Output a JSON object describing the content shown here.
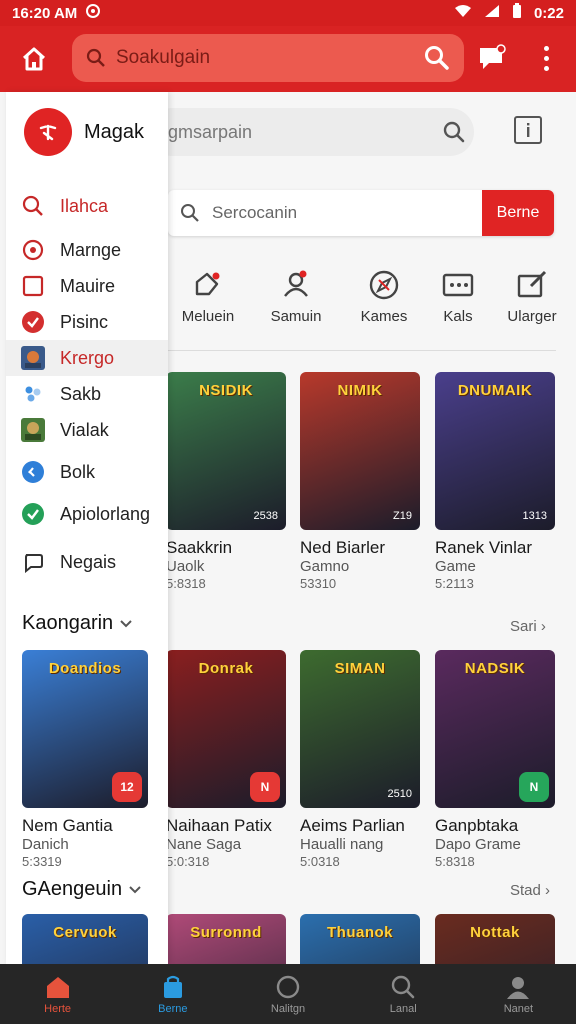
{
  "status_bar": {
    "time": "16:20 AM",
    "right_time": "0:22"
  },
  "header": {
    "search_placeholder": "Soakulgain"
  },
  "main": {
    "pill_search_placeholder": "gmsarpain",
    "search_bar": {
      "placeholder": "Sercocanin",
      "button_label": "Berne"
    },
    "categories": [
      {
        "label": "Meluein",
        "icon": "tag-icon"
      },
      {
        "label": "Samuin",
        "icon": "avatar-icon"
      },
      {
        "label": "Kames",
        "icon": "compass-icon"
      },
      {
        "label": "Kals",
        "icon": "gamepad-icon"
      },
      {
        "label": "Ularger",
        "icon": "edit-icon"
      }
    ],
    "featured": [
      {
        "title": "Saakkrin",
        "subtitle": "Uaolk",
        "num": "5:8318",
        "thumb_title": "NSIDIK",
        "size": "2538",
        "bg": "#3b7d4a"
      },
      {
        "title": "Ned Biarler",
        "subtitle": "Gamno",
        "num": "53310",
        "thumb_title": "NIMIK",
        "size": "Z19",
        "bg": "#b8392b"
      },
      {
        "title": "Ranek Vinlar",
        "subtitle": "Game",
        "num": "5:2113",
        "thumb_title": "DNUMAIK",
        "size": "1313",
        "bg": "#4a3f8c"
      }
    ],
    "section1": {
      "see_all": "Sari"
    },
    "section1_games": [
      {
        "title": "Nem Gantia",
        "subtitle": "Danich",
        "num": "5:3319",
        "thumb_title": "Doandios",
        "badge": "12",
        "badge_color": "#e53935",
        "bg": "#3a7fd6"
      },
      {
        "title": "Naihaan Patix",
        "subtitle": "Nane Saga",
        "num": "5:0:318",
        "thumb_title": "Donrak",
        "badge": "N",
        "badge_color": "#e53935",
        "bg": "#8a1f1f"
      },
      {
        "title": "Aeims Parlian",
        "subtitle": "Haualli nang",
        "num": "5:0318",
        "thumb_title": "SIMAN",
        "size": "2510",
        "bg": "#3d6b2f"
      },
      {
        "title": "Ganpbtaka",
        "subtitle": "Dapo Grame",
        "num": "5:8318",
        "thumb_title": "NADSIK",
        "badge": "N",
        "badge_color": "#26a65b",
        "bg": "#5a2a5e"
      }
    ],
    "section2": {
      "see_all": "Stad"
    },
    "section2_games": [
      {
        "thumb_title": "Cervuok",
        "bg": "#2a5fa8"
      },
      {
        "thumb_title": "Surronnd",
        "bg": "#b04a78"
      },
      {
        "thumb_title": "Thuanok",
        "bg": "#2b6fae"
      },
      {
        "thumb_title": "Nottak",
        "bg": "#6a2b1f"
      }
    ]
  },
  "drawer": {
    "user_name": "Magak",
    "items": [
      {
        "label": "Ilahca",
        "icon": "search-icon"
      },
      {
        "label": "Marnge",
        "icon": "target-icon"
      },
      {
        "label": "Mauire",
        "icon": "square-icon"
      },
      {
        "label": "Pisinc",
        "icon": "check-shield-icon"
      },
      {
        "label": "Krergo",
        "icon": "game-thumb-icon"
      },
      {
        "label": "Sakb",
        "icon": "dots-icon"
      },
      {
        "label": "Vialak",
        "icon": "game-thumb-icon"
      },
      {
        "label": "Bolk",
        "icon": "close-circle-icon"
      },
      {
        "label": "Apiolorlang",
        "icon": "check-circle-icon"
      },
      {
        "label": "Negais",
        "icon": "chat-icon"
      }
    ],
    "section1_title": "Kaongarin",
    "section2_title": "GAengeuin"
  },
  "bottom_nav": [
    {
      "label": "Herte",
      "icon": "home-icon"
    },
    {
      "label": "Berne",
      "icon": "bag-icon"
    },
    {
      "label": "Nalitgn",
      "icon": "circle-icon"
    },
    {
      "label": "Lanal",
      "icon": "search-icon"
    },
    {
      "label": "Nanet",
      "icon": "person-icon"
    }
  ],
  "colors": {
    "primary": "#d92323",
    "accent_red": "#e02424",
    "nav_bg": "#262626"
  }
}
